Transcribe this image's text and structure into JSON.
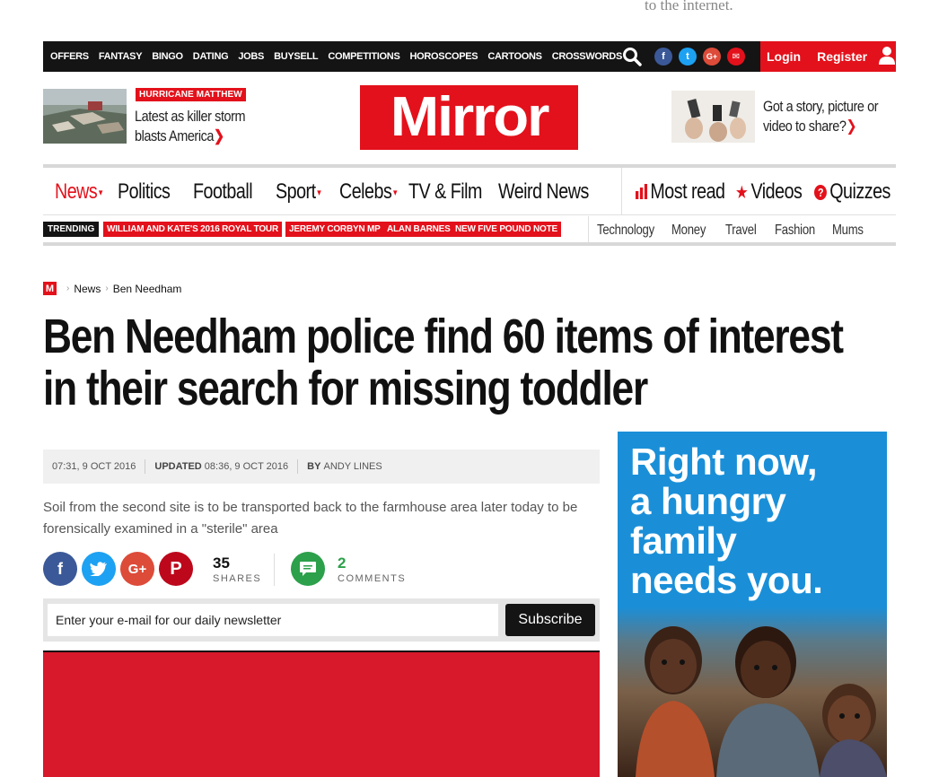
{
  "top_fade_text": "to the internet.",
  "topbar": {
    "links": [
      "OFFERS",
      "FANTASY",
      "BINGO",
      "DATING",
      "JOBS",
      "BUYSELL",
      "COMPETITIONS",
      "HOROSCOPES",
      "CARTOONS",
      "CROSSWORDS"
    ],
    "login": "Login",
    "register": "Register",
    "social": {
      "facebook": "f",
      "twitter": "t",
      "google": "G+",
      "email": "✉"
    }
  },
  "promo": {
    "tag": "HURRICANE MATTHEW",
    "text": "Latest as killer storm blasts America"
  },
  "logo": "Mirror",
  "story_promo": {
    "text": "Got a story, picture or video to share?"
  },
  "nav": {
    "items": [
      "News",
      "Politics",
      "Football",
      "Sport",
      "Celebs",
      "TV & Film",
      "Weird News"
    ],
    "right": [
      "Most read",
      "Videos",
      "Quizzes"
    ]
  },
  "trending": {
    "label": "TRENDING",
    "tags": [
      "WILLIAM AND KATE'S 2016 ROYAL TOUR",
      "JEREMY CORBYN MP",
      "ALAN BARNES",
      "NEW FIVE POUND NOTE"
    ],
    "sections": [
      "Technology",
      "Money",
      "Travel",
      "Fashion",
      "Mums"
    ]
  },
  "breadcrumb": {
    "logo": "M",
    "items": [
      "News",
      "Ben Needham"
    ]
  },
  "article": {
    "headline": "Ben Needham police find 60 items of interest in their search for missing toddler",
    "published": "07:31, 9 OCT 2016",
    "updated_label": "UPDATED",
    "updated": "08:36, 9 OCT 2016",
    "by_label": "BY",
    "author": "ANDY LINES",
    "standfirst": "Soil from the second site is to be transported back to the farmhouse area later today to be forensically examined in a \"sterile\" area"
  },
  "share": {
    "count": "35",
    "count_label": "SHARES",
    "comments": "2",
    "comments_label": "COMMENTS"
  },
  "newsletter": {
    "placeholder": "Enter your e-mail for our daily newsletter",
    "button": "Subscribe"
  },
  "ad": {
    "text_lines": [
      "Right now,",
      "a hungry",
      "family",
      "needs you."
    ]
  },
  "colors": {
    "brand_red": "#e3111b",
    "dark": "#141414",
    "ad_blue": "#1a8fd8"
  }
}
